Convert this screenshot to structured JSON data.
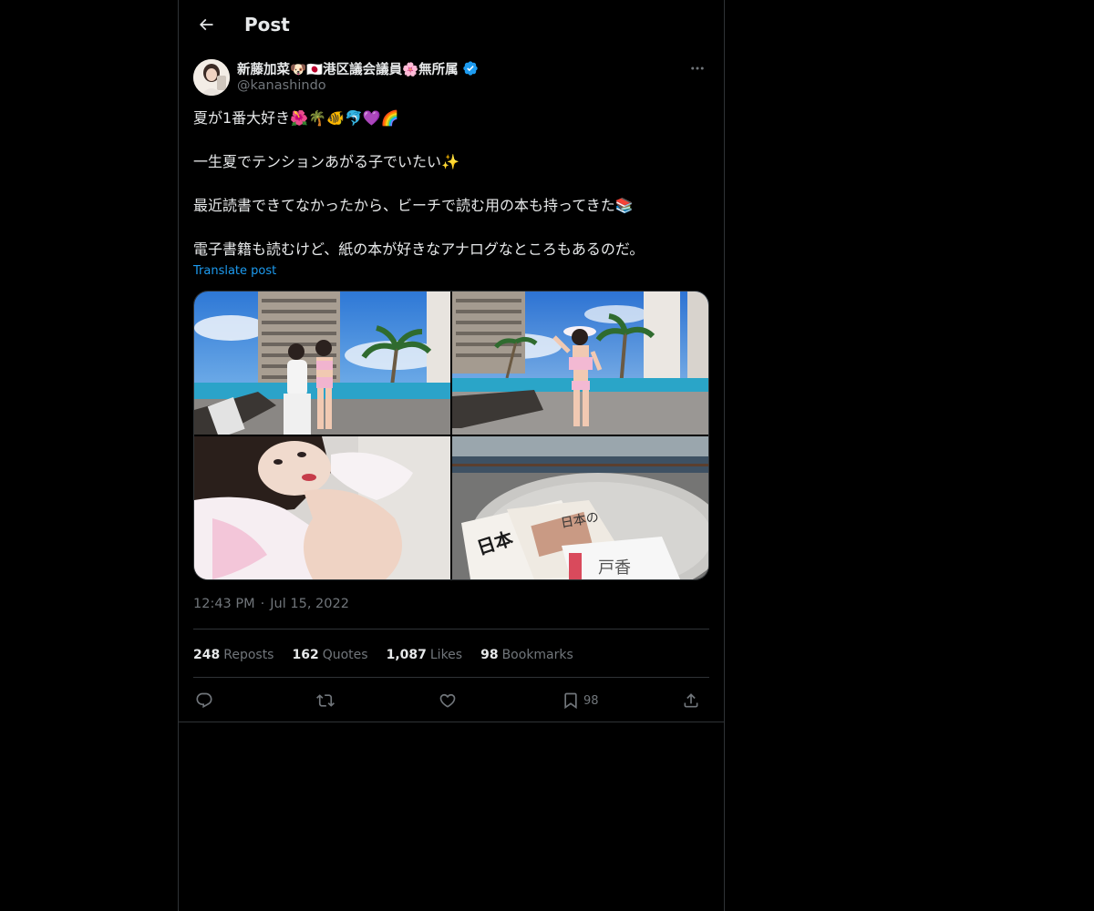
{
  "header": {
    "title": "Post",
    "back_icon": "arrow-left-icon"
  },
  "author": {
    "display_name": "新藤加菜🐶🇯🇵港区議会議員🌸無所属",
    "handle": "@kanashindo",
    "verified": true,
    "verified_color": "#1d9bf0"
  },
  "tweet": {
    "paragraphs": [
      "夏が1番大好き🌺🌴🐠🐬💜🌈",
      "一生夏でテンションあがる子でいたい✨",
      "最近読書できてなかったから、ビーチで読む用の本も持ってきた📚",
      "電子書籍も読むけど、紙の本が好きなアナログなところもあるのだ。"
    ],
    "translate_label": "Translate post",
    "time": "12:43 PM",
    "separator": "·",
    "date": "Jul 15, 2022"
  },
  "stats": [
    {
      "value": "248",
      "label": "Reposts"
    },
    {
      "value": "162",
      "label": "Quotes"
    },
    {
      "value": "1,087",
      "label": "Likes"
    },
    {
      "value": "98",
      "label": "Bookmarks"
    }
  ],
  "actions": {
    "reply_icon": "reply-icon",
    "repost_icon": "repost-icon",
    "like_icon": "heart-icon",
    "bookmark_icon": "bookmark-icon",
    "bookmark_count": "98",
    "share_icon": "share-icon"
  },
  "colors": {
    "background": "#000000",
    "text": "#e7e9ea",
    "muted": "#71767b",
    "border": "#2f3336",
    "accent": "#1d9bf0"
  }
}
